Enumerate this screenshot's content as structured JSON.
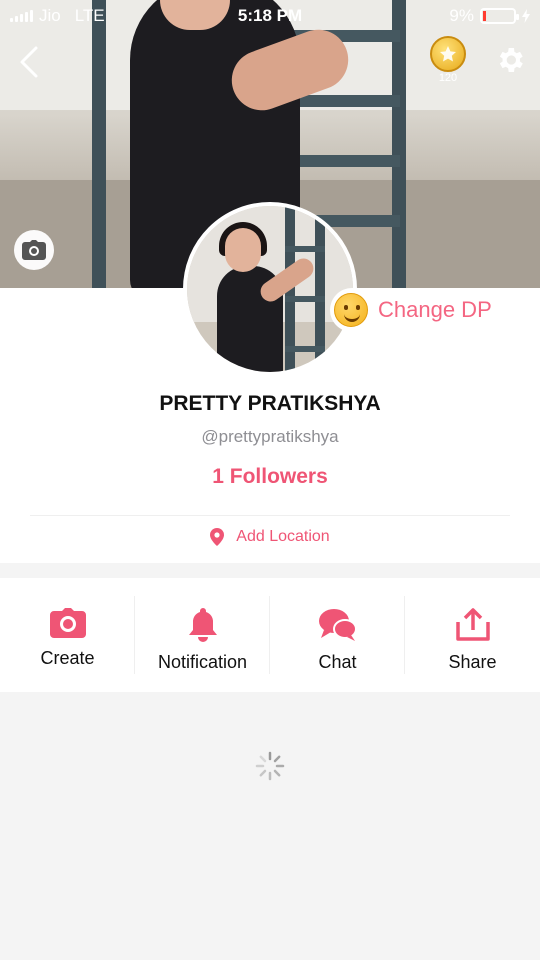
{
  "status_bar": {
    "carrier": "Jio",
    "network": "LTE",
    "time": "5:18 PM",
    "battery_percent": "9%",
    "battery_level": 0.09
  },
  "header": {
    "coins": "120",
    "icons": {
      "back": "chevron-left-icon",
      "settings": "gear-icon",
      "coin": "star-coin-icon",
      "cover_camera": "camera-icon"
    }
  },
  "profile": {
    "change_dp_label": "Change DP",
    "name": "PRETTY PRATIKSHYA",
    "handle": "@prettypratikshya",
    "followers": "1 Followers",
    "add_location": "Add Location"
  },
  "actions": [
    {
      "label": "Create",
      "icon": "camera-icon"
    },
    {
      "label": "Notification",
      "icon": "bell-icon"
    },
    {
      "label": "Chat",
      "icon": "chat-bubbles-icon"
    },
    {
      "label": "Share",
      "icon": "share-icon"
    }
  ],
  "colors": {
    "accent": "#ef5575",
    "accent_light": "#f46682",
    "background": "#f4f4f4"
  }
}
